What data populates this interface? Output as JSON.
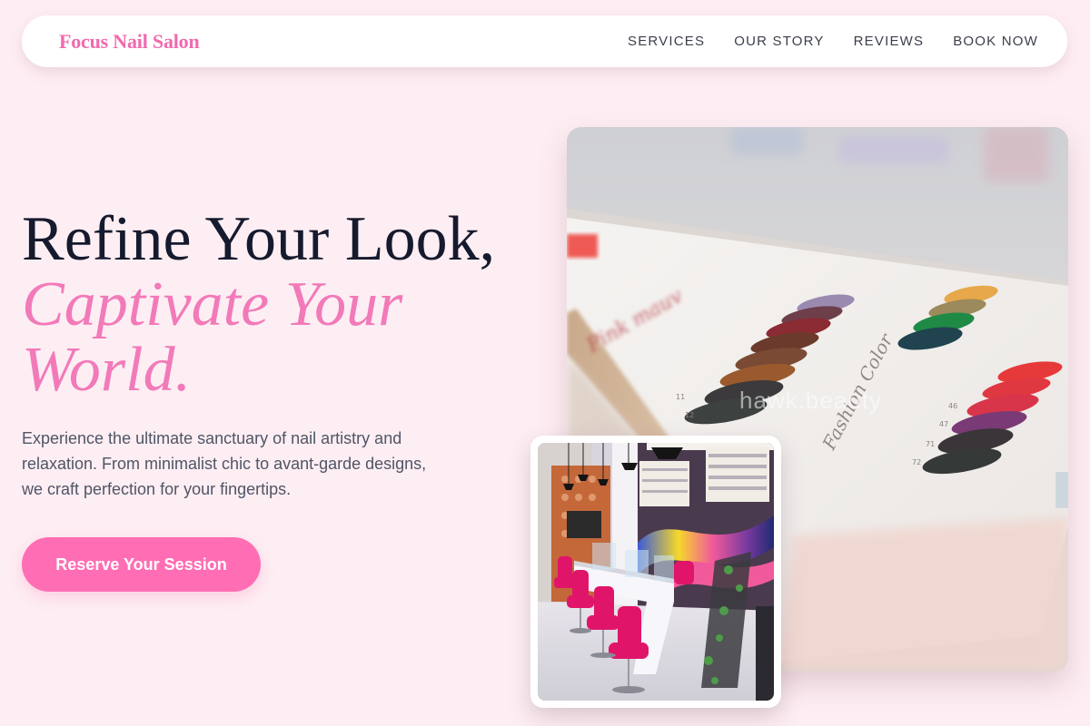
{
  "brand": {
    "name": "Focus Nail Salon"
  },
  "nav": {
    "items": [
      {
        "label": "SERVICES"
      },
      {
        "label": "OUR STORY"
      },
      {
        "label": "REVIEWS"
      },
      {
        "label": "BOOK NOW"
      }
    ]
  },
  "hero": {
    "title_line1": "Refine Your Look,",
    "title_line2": "Captivate Your",
    "title_line3": "World.",
    "description": "Experience the ultimate sanctuary of nail artistry and relaxation. From minimalist chic to avant-garde designs, we craft perfection for your fingertips.",
    "cta_label": "Reserve Your Session"
  },
  "images": {
    "main_photo": "nail-polish-swatch-display",
    "main_watermark": "hawk.beauty",
    "secondary_photo": "salon-interior-pink-chairs"
  },
  "colors": {
    "background": "#fdeef3",
    "brand_pink": "#f06aae",
    "accent_pink": "#f27ab9",
    "button_pink": "#ff6eb4",
    "heading_dark": "#161a2e",
    "body_text": "#505566"
  }
}
